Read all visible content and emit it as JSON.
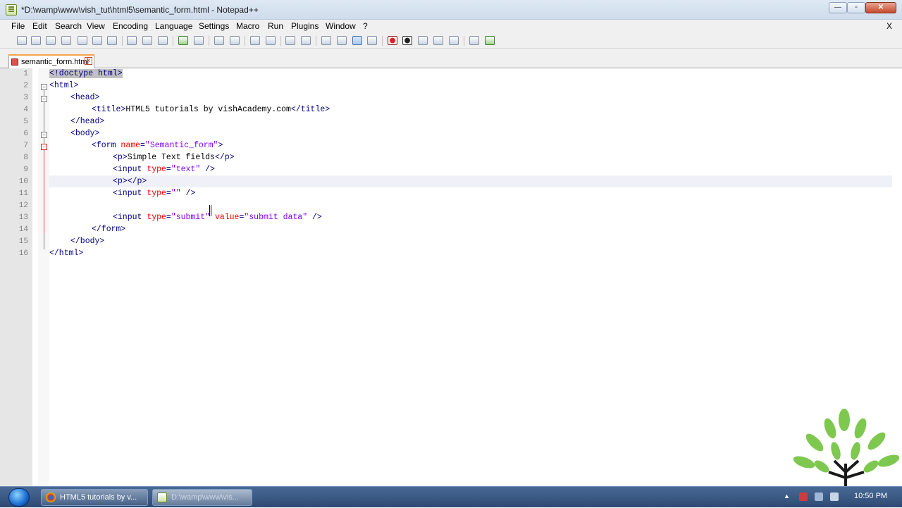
{
  "window": {
    "title": "*D:\\wamp\\www\\vish_tut\\html5\\semantic_form.html - Notepad++",
    "min_glyph": "—",
    "max_glyph": "▫",
    "close_glyph": "✕"
  },
  "menu": [
    "File",
    "Edit",
    "Search",
    "View",
    "Encoding",
    "Language",
    "Settings",
    "Macro",
    "Run",
    "Plugins",
    "Window",
    "?"
  ],
  "menu_close": "X",
  "tab": {
    "label": "semantic_form.html",
    "close": "✕"
  },
  "editor": {
    "line_numbers": [
      "1",
      "2",
      "3",
      "4",
      "5",
      "6",
      "7",
      "8",
      "9",
      "10",
      "11",
      "12",
      "13",
      "14",
      "15",
      "16"
    ],
    "lines": {
      "l1": {
        "a": "<!doctype html>"
      },
      "l2": {
        "a": "<html>"
      },
      "l3": {
        "a": "<head>"
      },
      "l4": {
        "a": "<title>",
        "b": "HTML5 tutorials by vishAcademy.com",
        "c": "</title>"
      },
      "l5": {
        "a": "</head>"
      },
      "l6": {
        "a": "<body>"
      },
      "l7": {
        "a": "<form ",
        "b": "name",
        "c": "=",
        "d": "\"Semantic_form\"",
        "e": ">"
      },
      "l8": {
        "a": "<p>",
        "b": "Simple Text fields",
        "c": "</p>"
      },
      "l9": {
        "a": "<input ",
        "b": "type",
        "c": "=",
        "d": "\"text\"",
        "e": " />"
      },
      "l10": {
        "a": "<p></p>"
      },
      "l11": {
        "a": "<input ",
        "b": "type",
        "c": "=",
        "d": "\"\"",
        "e": " />"
      },
      "l12": {
        "a": ""
      },
      "l13": {
        "a": "<input ",
        "b": "type",
        "c": "=",
        "d": "\"submit\"",
        "e": " ",
        "f": "value",
        "g": "=",
        "h": "\"submit data\"",
        "i": " />"
      },
      "l14": {
        "a": "</form>"
      },
      "l15": {
        "a": "</body>"
      },
      "l16": {
        "a": "</html>"
      }
    }
  },
  "taskbar": {
    "items": [
      {
        "label": "HTML5 tutorials by v..."
      },
      {
        "label": "D:\\wamp\\www\\vis..."
      }
    ],
    "clock": "10:50 PM"
  },
  "colors": {
    "tag": "#000080",
    "attr": "#ff0000",
    "string": "#8000ff",
    "text": "#000000",
    "tab_accent": "#f7a24b"
  },
  "icons": [
    "notepadpp-app-icon",
    "new-file-icon",
    "open-file-icon",
    "save-icon",
    "save-all-icon",
    "close-icon",
    "close-all-icon",
    "print-icon",
    "cut-icon",
    "copy-icon",
    "paste-icon",
    "undo-icon",
    "redo-icon",
    "find-icon",
    "replace-icon",
    "zoom-in-icon",
    "zoom-out-icon",
    "sync-v-icon",
    "sync-h-icon",
    "word-wrap-icon",
    "show-all-chars-icon",
    "indent-guide-icon",
    "user-lang-icon",
    "record-macro-icon",
    "stop-macro-icon",
    "play-macro-icon",
    "run-macro-multiple-icon",
    "save-macro-icon",
    "launch-browser-icon",
    "spell-check-icon",
    "tree-logo"
  ]
}
